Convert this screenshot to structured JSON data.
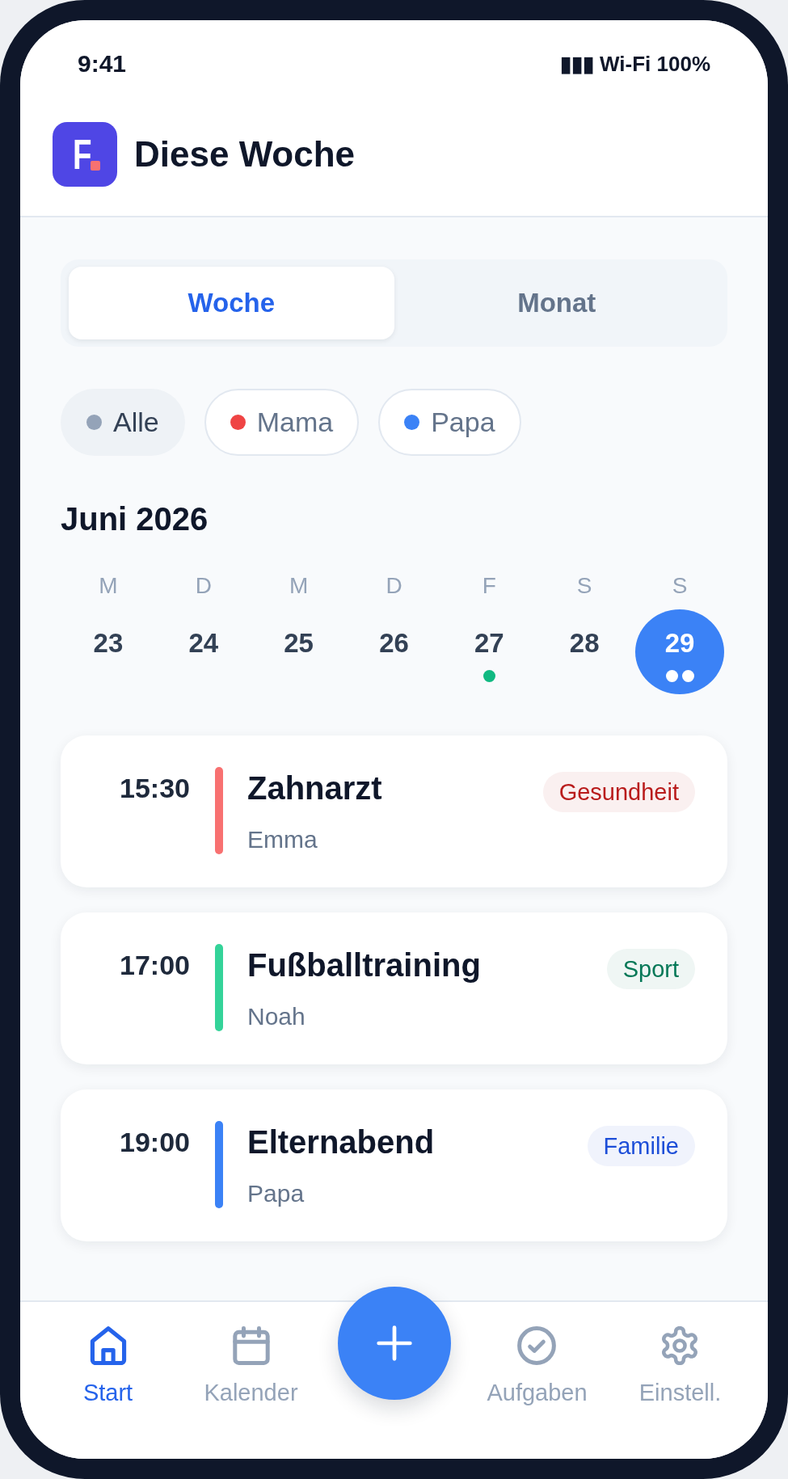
{
  "status_bar": {
    "time": "9:41",
    "indicators": "▮▮▮ Wi-Fi 100%"
  },
  "header": {
    "logo_letter": "F",
    "title": "Diese Woche"
  },
  "view_tabs": [
    {
      "label": "Woche",
      "selected": true
    },
    {
      "label": "Monat",
      "selected": false
    }
  ],
  "filters": [
    {
      "label": "Alle",
      "color": "#94a3b8",
      "selected": true
    },
    {
      "label": "Mama",
      "color": "#ef4444",
      "selected": false
    },
    {
      "label": "Papa",
      "color": "#3b82f6",
      "selected": false
    }
  ],
  "calendar": {
    "month": "Juni 2026",
    "days": [
      {
        "weekday": "M",
        "date": "23",
        "selected": false
      },
      {
        "weekday": "D",
        "date": "24",
        "selected": false
      },
      {
        "weekday": "M",
        "date": "25",
        "selected": false
      },
      {
        "weekday": "D",
        "date": "26",
        "selected": false
      },
      {
        "weekday": "F",
        "date": "27",
        "selected": false,
        "dots": [
          {
            "color": "#10b981"
          }
        ]
      },
      {
        "weekday": "S",
        "date": "28",
        "selected": false
      },
      {
        "weekday": "S",
        "date": "29",
        "selected": true,
        "dots": [
          {
            "color": "#ffffff"
          },
          {
            "color": "#ffffff"
          }
        ]
      }
    ]
  },
  "events": [
    {
      "time": "15:30",
      "title": "Zahnarzt",
      "person": "Emma",
      "color": "#f87171",
      "tag": {
        "label": "Gesundheit",
        "color": "#b91c1c"
      }
    },
    {
      "time": "17:00",
      "title": "Fußballtraining",
      "person": "Noah",
      "color": "#34d399",
      "tag": {
        "label": "Sport",
        "color": "#047857"
      }
    },
    {
      "time": "19:00",
      "title": "Elternabend",
      "person": "Papa",
      "color": "#3b82f6",
      "tag": {
        "label": "Familie",
        "color": "#1d4ed8"
      }
    }
  ],
  "bottom_nav": {
    "items": [
      {
        "kind": "tab",
        "label": "Start",
        "selected": true
      },
      {
        "kind": "tab",
        "label": "Kalender",
        "selected": false
      },
      {
        "kind": "add"
      },
      {
        "kind": "tab",
        "label": "Aufgaben",
        "selected": false
      },
      {
        "kind": "tab",
        "label": "Einstell.",
        "selected": false
      }
    ]
  }
}
